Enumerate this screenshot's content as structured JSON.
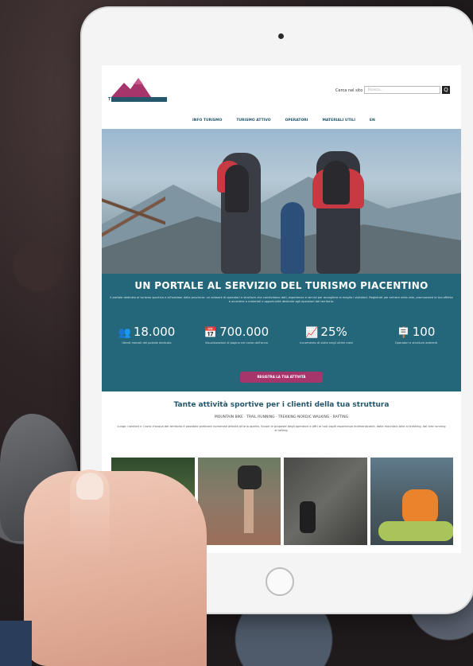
{
  "site": {
    "logo_text": "TURISMO VALLEY",
    "search_label": "Cerca nel sito",
    "search_placeholder": "Ricerca...",
    "search_button": "Q"
  },
  "nav": {
    "items": [
      "INFO TURISMO",
      "TURISMO ATTIVO",
      "OPERATORI",
      "MATERIALI UTILI",
      "EN"
    ]
  },
  "banner": {
    "title": "UN PORTALE AL SERVIZIO DEL TURISMO PIACENTINO",
    "text": "Il portale dedicato al turismo sportivo e all'outdoor della provincia: un network di operatori e strutture che condividono dati, esperienze e servizi per accogliere al meglio i visitatori. Registrati per entrare nella rete, promuovere la tua offerta e accedere a materiali e opportunità dedicate agli operatori del territorio.",
    "stats": [
      {
        "icon": "users-icon",
        "glyph": "👥",
        "value": "18.000",
        "desc": "Utenti mensili del portale dedicato"
      },
      {
        "icon": "calendar-icon",
        "glyph": "📅",
        "value": "700.000",
        "desc": "Visualizzazioni di pagina nel corso dell'anno"
      },
      {
        "icon": "trend-icon",
        "glyph": "📈",
        "value": "25%",
        "desc": "Incremento di visite negli ultimi mesi"
      },
      {
        "icon": "signpost-icon",
        "glyph": "🪧",
        "value": "100",
        "desc": "Operatori e strutture aderenti"
      }
    ],
    "cta_label": "REGISTRA LA TUA ATTIVITÀ"
  },
  "sports": {
    "title": "Tante attività sportive per i clienti della tua struttura",
    "subtitle": "MOUNTAIN BIKE · TRAIL RUNNING · TREKKING NORDIC WALKING · RAFTING",
    "text": "Lungo i sentieri e i corsi d'acqua del territorio è possibile praticare numerose attività all'aria aperta. Scopri le proposte degli operatori e offri ai tuoi ospiti esperienze indimenticabili, dalla mountain bike al trekking, dal trail running al rafting."
  },
  "colors": {
    "brand_teal": "#24677a",
    "brand_dark": "#24576b",
    "accent_magenta": "#a6356b"
  }
}
